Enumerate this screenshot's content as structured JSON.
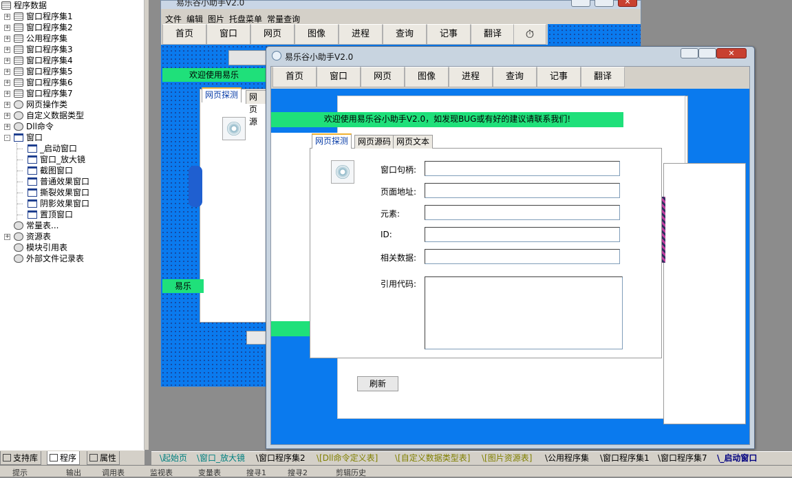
{
  "tree": {
    "root": "程序数据",
    "items": [
      {
        "label": "窗口程序集1",
        "icon": "book-icon",
        "expand": "+"
      },
      {
        "label": "窗口程序集2",
        "icon": "book-icon",
        "expand": "+"
      },
      {
        "label": "公用程序集",
        "icon": "book-icon",
        "expand": "+"
      },
      {
        "label": "窗口程序集3",
        "icon": "book-icon",
        "expand": "+"
      },
      {
        "label": "窗口程序集4",
        "icon": "book-icon",
        "expand": "+"
      },
      {
        "label": "窗口程序集5",
        "icon": "book-icon",
        "expand": "+"
      },
      {
        "label": "窗口程序集6",
        "icon": "book-icon",
        "expand": "+"
      },
      {
        "label": "窗口程序集7",
        "icon": "book-icon",
        "expand": "+"
      },
      {
        "label": "网页操作类",
        "icon": "class-icon",
        "expand": "+"
      },
      {
        "label": "自定义数据类型",
        "icon": "datatype-icon",
        "expand": "+"
      },
      {
        "label": "Dll命令",
        "icon": "dll-icon",
        "expand": "+"
      },
      {
        "label": "窗口",
        "icon": "window-icon",
        "expand": "-"
      }
    ],
    "window_children": [
      "_启动窗口",
      "窗口_放大镜",
      "截图窗口",
      "普通效果窗口",
      "撕裂效果窗口",
      "阴影效果窗口",
      "置顶窗口"
    ],
    "tail": [
      {
        "label": "常量表...",
        "icon": "constant-icon"
      },
      {
        "label": "资源表",
        "icon": "resource-icon",
        "expand": "+"
      },
      {
        "label": "模块引用表",
        "icon": "module-icon"
      },
      {
        "label": "外部文件记录表",
        "icon": "file-icon"
      }
    ]
  },
  "bottom_tabs": [
    "支持库",
    "程序",
    "属性"
  ],
  "doc_tabs": [
    {
      "label": "起始页",
      "style": "teal"
    },
    {
      "label": "窗口_放大镜",
      "style": "teal"
    },
    {
      "label": "窗口程序集2",
      "style": "blk"
    },
    {
      "label": "[Dll命令定义表]",
      "style": "olive"
    },
    {
      "label": "[自定义数据类型表]",
      "style": "olive"
    },
    {
      "label": "[图片资源表]",
      "style": "olive"
    },
    {
      "label": "公用程序集",
      "style": "blk"
    },
    {
      "label": "窗口程序集1",
      "style": "blk"
    },
    {
      "label": "窗口程序集7",
      "style": "blk"
    },
    {
      "label": "_启动窗口",
      "style": "act"
    }
  ],
  "status": [
    "提示",
    "输出",
    "调用表",
    "监视表",
    "变量表",
    "搜寻1",
    "搜寻2",
    "剪辑历史"
  ],
  "back_window": {
    "title": "易乐谷小助手V2.0",
    "menu": [
      "文件",
      "编辑",
      "图片",
      "托盘菜单",
      "常量查询"
    ],
    "toolbar": [
      "首页",
      "窗口",
      "网页",
      "图像",
      "进程",
      "查询",
      "记事",
      "翻译"
    ],
    "banner": "欢迎使用易乐",
    "banner2": "易乐",
    "banner3": "易乐",
    "tabs": [
      "网页探测",
      "网页源"
    ],
    "refresh": "刷新"
  },
  "front_window": {
    "title": "易乐谷小助手V2.0",
    "toolbar": [
      "首页",
      "窗口",
      "网页",
      "图像",
      "进程",
      "查询",
      "记事",
      "翻译"
    ],
    "banner": "欢迎使用易乐谷小助手V2.0，如发现BUG或有好的建议请联系我们!",
    "tabs": [
      "网页探测",
      "网页源码",
      "网页文本"
    ],
    "fields": [
      {
        "label": "窗口句柄:",
        "value": ""
      },
      {
        "label": "页面地址:",
        "value": ""
      },
      {
        "label": "元素:",
        "value": ""
      },
      {
        "label": "ID:",
        "value": ""
      },
      {
        "label": "相关数据:",
        "value": ""
      }
    ],
    "code_label": "引用代码:",
    "code_value": ""
  },
  "colors": {
    "client_blue": "#0a7aee",
    "banner_green": "#1fe07a",
    "tab_highlight": "#f0b030"
  }
}
